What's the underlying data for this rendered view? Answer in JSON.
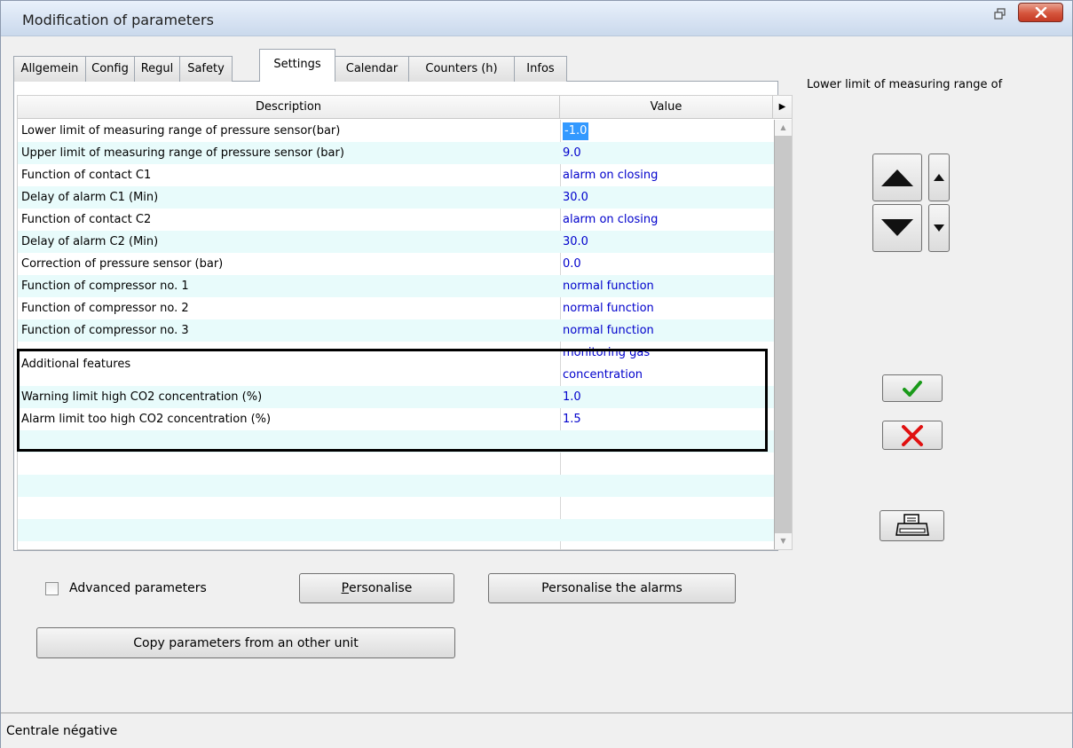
{
  "window": {
    "title": "Modification of parameters"
  },
  "tabs": [
    {
      "label": "Allgemein"
    },
    {
      "label": "Config"
    },
    {
      "label": "Regul"
    },
    {
      "label": "Safety"
    },
    {
      "label": "Settings",
      "active": true
    },
    {
      "label": "Calendar"
    },
    {
      "label": "Counters (h)"
    },
    {
      "label": "Infos"
    }
  ],
  "grid": {
    "headers": {
      "description": "Description",
      "value": "Value"
    },
    "rows": [
      {
        "description": "Lower limit of measuring range of pressure sensor(bar)",
        "value": "-1.0",
        "selected": true
      },
      {
        "description": "Upper limit of measuring range of pressure sensor (bar)",
        "value": "9.0"
      },
      {
        "description": "Function of contact C1",
        "value": "alarm on closing"
      },
      {
        "description": "Delay of alarm C1 (Min)",
        "value": "30.0"
      },
      {
        "description": "Function of contact C2",
        "value": "alarm on closing"
      },
      {
        "description": "Delay of alarm C2 (Min)",
        "value": "30.0"
      },
      {
        "description": "Correction of pressure sensor (bar)",
        "value": "0.0"
      },
      {
        "description": "Function of compressor no. 1",
        "value": "normal function"
      },
      {
        "description": "Function of compressor no. 2",
        "value": "normal function"
      },
      {
        "description": "Function of compressor no. 3",
        "value": "normal function"
      },
      {
        "description": "Additional features",
        "value": "monitoring gas concentration"
      },
      {
        "description": "Warning limit high CO2 concentration (%)",
        "value": "1.0"
      },
      {
        "description": "Alarm limit too high CO2 concentration (%)",
        "value": "1.5"
      }
    ]
  },
  "side_panel": {
    "selected_param_label": "Lower limit of measuring range of"
  },
  "bottom": {
    "advanced_checkbox_label": "Advanced parameters",
    "advanced_checked": false,
    "personalise_prefix": "P",
    "personalise_rest": "ersonalise",
    "personalise_alarms_label": "Personalise the alarms",
    "copy_label": "Copy parameters from an other unit"
  },
  "status": {
    "text": "Centrale négative"
  },
  "colors": {
    "value_text": "#0000cc",
    "alt_row": "#e8fbfb",
    "selection": "#3399ff",
    "cancel_red": "#e01010",
    "ok_green": "#1a9a1a"
  },
  "icons": [
    "restore-icon",
    "close-icon",
    "big-up-arrow-icon",
    "big-down-arrow-icon",
    "small-up-arrow-icon",
    "small-down-arrow-icon",
    "checkmark-icon",
    "cross-icon",
    "printer-icon"
  ]
}
